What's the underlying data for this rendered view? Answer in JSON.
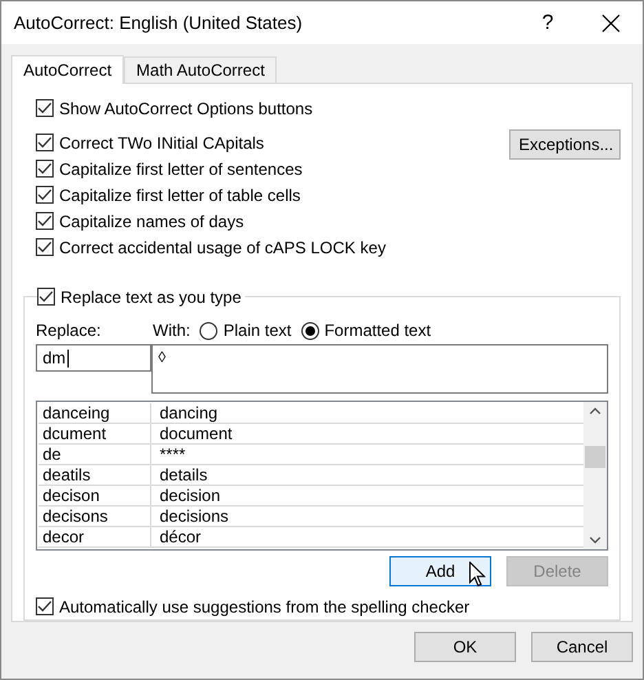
{
  "window": {
    "title": "AutoCorrect: English (United States)",
    "help": "?"
  },
  "tabs": [
    {
      "label": "AutoCorrect",
      "selected": true
    },
    {
      "label": "Math AutoCorrect",
      "selected": false
    }
  ],
  "show_options": {
    "label": "Show AutoCorrect Options buttons",
    "checked": true
  },
  "options": [
    {
      "label": "Correct TWo INitial CApitals",
      "checked": true
    },
    {
      "label": "Capitalize first letter of sentences",
      "checked": true
    },
    {
      "label": "Capitalize first letter of table cells",
      "checked": true
    },
    {
      "label": "Capitalize names of days",
      "checked": true
    },
    {
      "label": "Correct accidental usage of cAPS LOCK key",
      "checked": true
    }
  ],
  "exceptions_button": {
    "label": "Exceptions..."
  },
  "replace_group": {
    "label": "Replace text as you type",
    "checked": true,
    "replace_label": {
      "label": "Replace:"
    },
    "with_label": {
      "label": "With:"
    },
    "formats": [
      {
        "label": "Plain text",
        "selected": false
      },
      {
        "label": "Formatted text",
        "selected": true
      }
    ],
    "replace_value": "dm",
    "with_value": "◊",
    "entries": [
      {
        "word": "danceing",
        "replacement": "dancing"
      },
      {
        "word": "dcument",
        "replacement": "document"
      },
      {
        "word": "de",
        "replacement": "****"
      },
      {
        "word": "deatils",
        "replacement": "details"
      },
      {
        "word": "decison",
        "replacement": "decision"
      },
      {
        "word": "decisons",
        "replacement": "decisions"
      },
      {
        "word": "decor",
        "replacement": "décor"
      }
    ],
    "buttons": [
      {
        "label": "Add",
        "highlighted": true,
        "disabled": false
      },
      {
        "label": "Delete",
        "highlighted": false,
        "disabled": true
      }
    ],
    "spelling": {
      "label": "Automatically use suggestions from the spelling checker",
      "checked": true
    }
  },
  "footer_buttons": [
    {
      "label": "OK"
    },
    {
      "label": "Cancel"
    }
  ]
}
